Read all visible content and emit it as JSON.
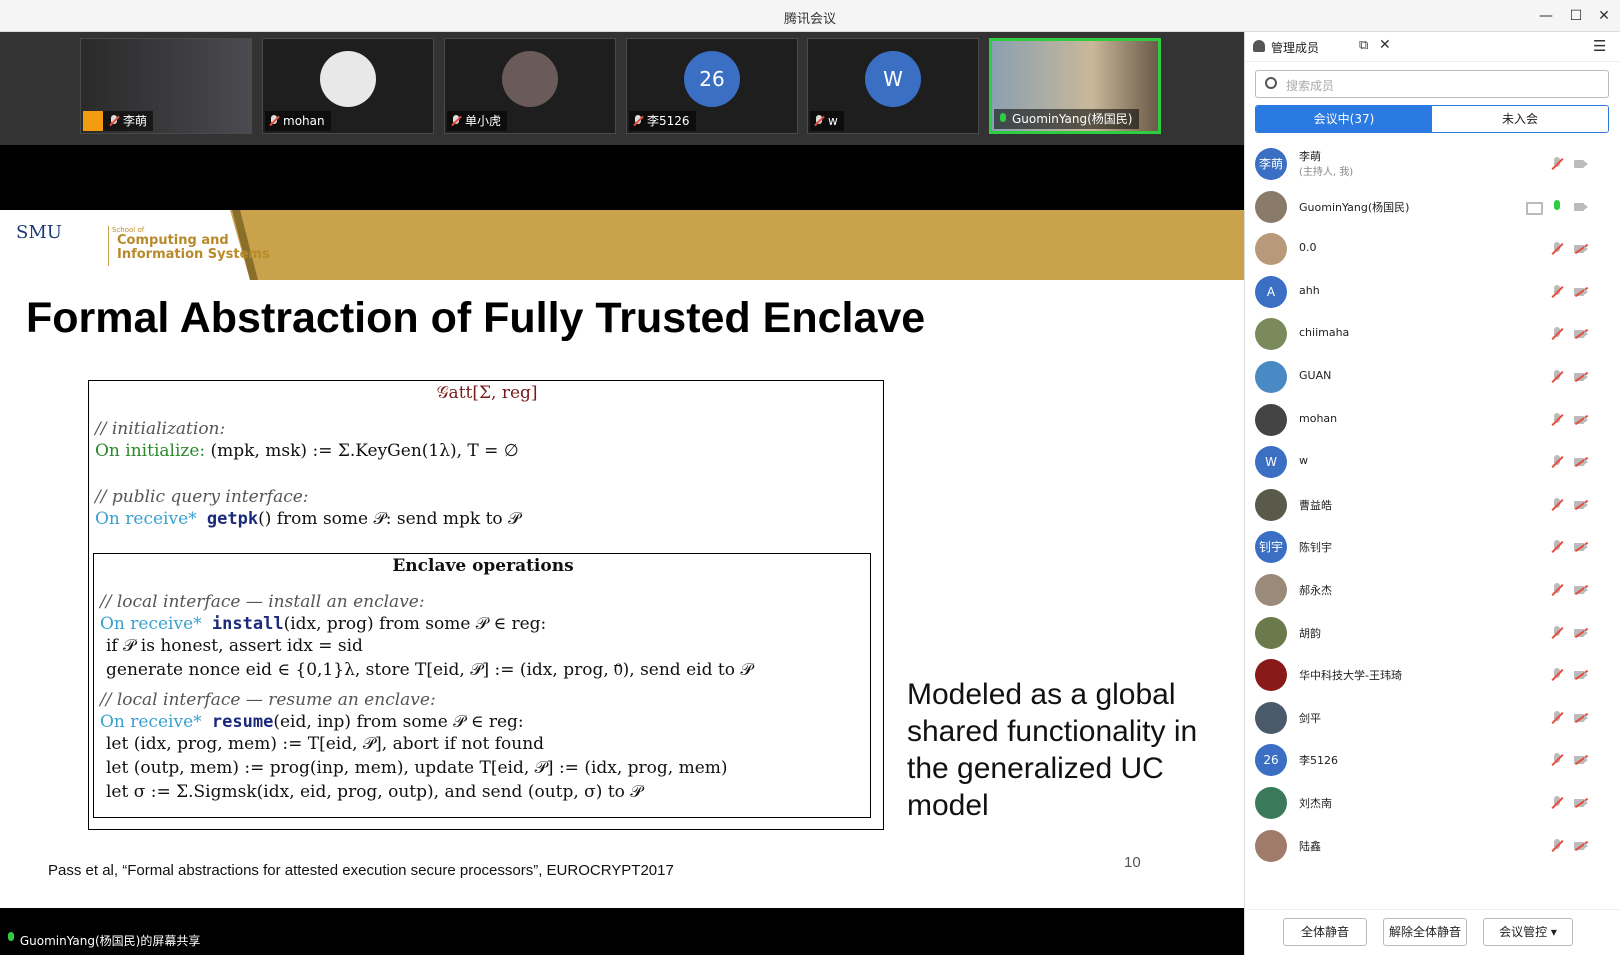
{
  "window": {
    "title": "腾讯会议"
  },
  "thumbs": [
    {
      "name": "李萌",
      "type": "video",
      "mic": "muted",
      "host": true
    },
    {
      "name": "mohan",
      "type": "avatar-img",
      "mic": "muted"
    },
    {
      "name": "单小虎",
      "type": "avatar-img",
      "mic": "muted"
    },
    {
      "name": "李5126",
      "type": "avatar-text",
      "avatar_text": "26",
      "mic": "muted"
    },
    {
      "name": "w",
      "type": "avatar-text",
      "avatar_text": "W",
      "mic": "muted"
    },
    {
      "name": "GuominYang(杨国民)",
      "type": "video",
      "mic": "on",
      "active": true
    }
  ],
  "slide": {
    "logo_smu": "SMU",
    "logo_school": "School of",
    "logo_dept_1": "Computing and",
    "logo_dept_2": "Information Systems",
    "title": "Formal Abstraction of Fully Trusted Enclave",
    "box_header": "𝒢att[Σ, reg]",
    "l1": "// initialization:",
    "l2a": "On initialize:",
    "l2b": " (mpk, msk) := Σ.KeyGen(1λ),  T = ∅",
    "l3": "// public query interface:",
    "l4a": "On receive*",
    "l4b": " getpk",
    "l4c": "() from some 𝒫: send mpk to 𝒫",
    "inner_header": "Enclave operations",
    "i1": "// local interface — install an enclave:",
    "i2a": "On receive*",
    "i2b": " install",
    "i2c": "(idx, prog) from some 𝒫 ∈ reg:",
    "i3": "if 𝒫 is honest, assert idx = sid",
    "i4": "generate nonce eid ∈ {0,1}λ,  store T[eid, 𝒫] := (idx, prog, 0⃗), send eid to 𝒫",
    "i5": "// local interface — resume an enclave:",
    "i6a": "On receive*",
    "i6b": " resume",
    "i6c": "(eid, inp) from some 𝒫 ∈ reg:",
    "i7": "let (idx, prog, mem) := T[eid, 𝒫], abort if not found",
    "i8": "let (outp, mem) := prog(inp, mem), update T[eid, 𝒫] := (idx, prog, mem)",
    "i9": "let σ := Σ.Sigmsk(idx, eid, prog, outp), and send (outp, σ) to 𝒫",
    "side_text": "Modeled as a global shared functionality in the generalized UC model",
    "citation": "Pass et al,  “Formal abstractions for attested execution secure processors”, EUROCRYPT2017",
    "page_number": "10"
  },
  "share_bar": "GuominYang(杨国民)的屏幕共享",
  "panel": {
    "header": "管理成员",
    "search_placeholder": "搜索成员",
    "tab_in": "会议中(37)",
    "tab_out": "未入会",
    "members": [
      {
        "name": "李萌",
        "role": "(主持人, 我)",
        "avatar_text": "李萌",
        "avatar_color": "#3a6fc4",
        "mic": "muted",
        "cam": "on"
      },
      {
        "name": "GuominYang(杨国民)",
        "avatar_text": "",
        "avatar_color": "#8a7a6a",
        "mic": "on",
        "cam": "on",
        "screen": true
      },
      {
        "name": "0.0",
        "avatar_text": "",
        "avatar_color": "#b89a7a",
        "mic": "muted",
        "cam": "off"
      },
      {
        "name": "ahh",
        "avatar_text": "A",
        "avatar_color": "#3a6fc4",
        "mic": "muted",
        "cam": "off"
      },
      {
        "name": "chiimaha",
        "avatar_text": "",
        "avatar_color": "#7a8a5a",
        "mic": "muted",
        "cam": "off"
      },
      {
        "name": "GUAN",
        "avatar_text": "",
        "avatar_color": "#4a8ac4",
        "mic": "muted",
        "cam": "off"
      },
      {
        "name": "mohan",
        "avatar_text": "",
        "avatar_color": "#444444",
        "mic": "muted",
        "cam": "off"
      },
      {
        "name": "w",
        "avatar_text": "W",
        "avatar_color": "#3a6fc4",
        "mic": "muted",
        "cam": "off"
      },
      {
        "name": "曹益皓",
        "avatar_text": "",
        "avatar_color": "#5a5a4a",
        "mic": "muted",
        "cam": "off"
      },
      {
        "name": "陈钊宇",
        "avatar_text": "钊宇",
        "avatar_color": "#3a6fc4",
        "mic": "muted",
        "cam": "off"
      },
      {
        "name": "郝永杰",
        "avatar_text": "",
        "avatar_color": "#9a8a7a",
        "mic": "muted",
        "cam": "off"
      },
      {
        "name": "胡韵",
        "avatar_text": "",
        "avatar_color": "#6a7a4a",
        "mic": "muted",
        "cam": "off"
      },
      {
        "name": "华中科技大学-王玮琦",
        "avatar_text": "",
        "avatar_color": "#8a1a1a",
        "mic": "muted",
        "cam": "off"
      },
      {
        "name": "剑平",
        "avatar_text": "",
        "avatar_color": "#4a5a6a",
        "mic": "muted",
        "cam": "off"
      },
      {
        "name": "李5126",
        "avatar_text": "26",
        "avatar_color": "#3a6fc4",
        "mic": "muted",
        "cam": "off"
      },
      {
        "name": "刘杰南",
        "avatar_text": "",
        "avatar_color": "#3a7a5a",
        "mic": "muted",
        "cam": "off"
      },
      {
        "name": "陆鑫",
        "avatar_text": "",
        "avatar_color": "#a07a6a",
        "mic": "muted",
        "cam": "off"
      }
    ],
    "btn_mute_all": "全体静音",
    "btn_unmute_all": "解除全体静音",
    "btn_manage": "会议管控 ▾"
  },
  "colors": {
    "accent": "#2a7ae2",
    "slide_band": "#c8a34b",
    "active_border": "#2ecc40"
  }
}
